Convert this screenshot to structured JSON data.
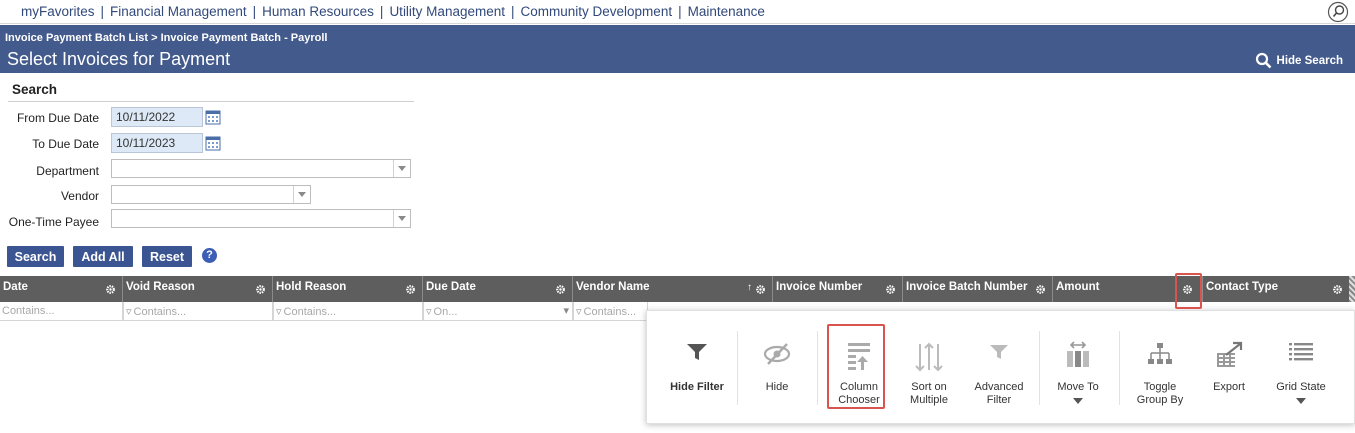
{
  "topnav": {
    "items": [
      "myFavorites",
      "Financial Management",
      "Human Resources",
      "Utility Management",
      "Community Development",
      "Maintenance"
    ]
  },
  "header": {
    "breadcrumb": "Invoice Payment Batch List > Invoice Payment Batch - Payroll",
    "title": "Select Invoices for Payment",
    "hide_search": "Hide Search"
  },
  "search": {
    "title": "Search",
    "from_due_date_label": "From Due Date",
    "from_due_date": "10/11/2022",
    "to_due_date_label": "To Due Date",
    "to_due_date": "10/11/2023",
    "department_label": "Department",
    "vendor_label": "Vendor",
    "one_time_payee_label": "One-Time Payee",
    "buttons": {
      "search": "Search",
      "add_all": "Add All",
      "reset": "Reset"
    },
    "help": "?"
  },
  "grid": {
    "columns": [
      "Date",
      "Void Reason",
      "Hold Reason",
      "Due Date",
      "Vendor Name",
      "Invoice Number",
      "Invoice Batch Number",
      "Amount",
      "Contact Type"
    ],
    "filters": [
      "Contains...",
      "Contains...",
      "Contains...",
      "On...",
      "Contains..."
    ],
    "sort_indicator": "↑"
  },
  "popup": {
    "tools": [
      {
        "label": "Hide Filter",
        "icon": "funnel-icon"
      },
      {
        "label": "Hide",
        "icon": "eye-slash-icon"
      },
      {
        "label": "Column Chooser",
        "icon": "column-chooser-icon"
      },
      {
        "label": "Sort on Multiple",
        "icon": "sort-arrows-icon"
      },
      {
        "label": "Advanced Filter",
        "icon": "funnel-icon"
      },
      {
        "label": "Move To",
        "icon": "move-column-icon"
      },
      {
        "label": "Toggle Group By",
        "icon": "hierarchy-icon"
      },
      {
        "label": "Export",
        "icon": "export-icon"
      },
      {
        "label": "Grid State",
        "icon": "list-icon"
      }
    ]
  },
  "colors": {
    "header_bg": "#435a8c",
    "button_bg": "#3b5592",
    "grid_head_bg": "#5e5e5e",
    "highlight": "#d9534f",
    "link": "#31497b"
  }
}
